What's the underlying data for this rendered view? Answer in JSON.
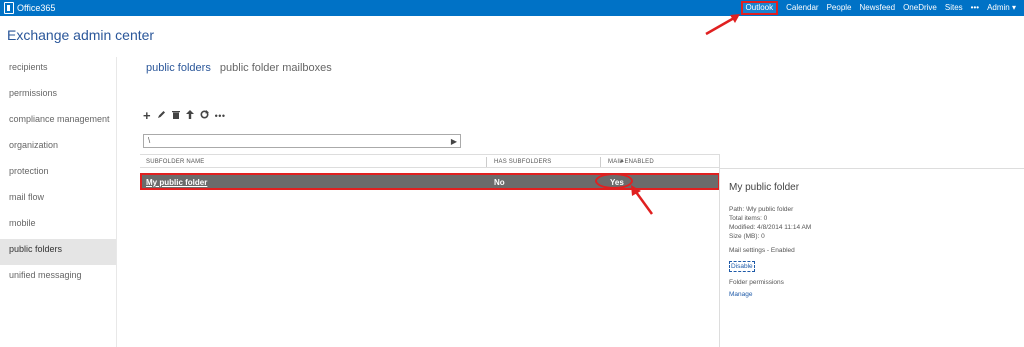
{
  "brand": {
    "name": "Office365"
  },
  "nav": [
    "Outlook",
    "Calendar",
    "People",
    "Newsfeed",
    "OneDrive",
    "Sites",
    "•••",
    "Admin ▾"
  ],
  "app_title": "Exchange admin center",
  "leftnav": {
    "items": [
      "recipients",
      "permissions",
      "compliance management",
      "organization",
      "protection",
      "mail flow",
      "mobile",
      "public folders",
      "unified messaging"
    ],
    "active_index": 7
  },
  "tabs": [
    "public folders",
    "public folder mailboxes"
  ],
  "toolbar": {
    "icons": [
      "add-icon",
      "edit-icon",
      "delete-icon",
      "up-icon",
      "refresh-icon",
      "more-icon"
    ]
  },
  "search": {
    "value": "\\",
    "go_icon": "▶"
  },
  "grid": {
    "headers": [
      "SUBFOLDER NAME",
      "HAS SUBFOLDERS",
      "MAIL ENABLED"
    ],
    "rows": [
      {
        "name": "My public folder",
        "has_subfolders": "No",
        "mail_enabled": "Yes"
      }
    ]
  },
  "detail": {
    "title": "My public folder",
    "path": "Path: \\My public folder",
    "total_items": "Total items: 0",
    "modified": "Modified: 4/8/2014 11:14 AM",
    "size": "Size (MB): 0",
    "mail_settings": "Mail settings - Enabled",
    "disable_link": "Disable",
    "folder_permissions": "Folder permissions",
    "manage_link": "Manage"
  },
  "colors": {
    "topbar": "#0072c6",
    "accent": "#2b579a",
    "highlight": "#e02020",
    "row_selected": "#6b6b6b"
  }
}
